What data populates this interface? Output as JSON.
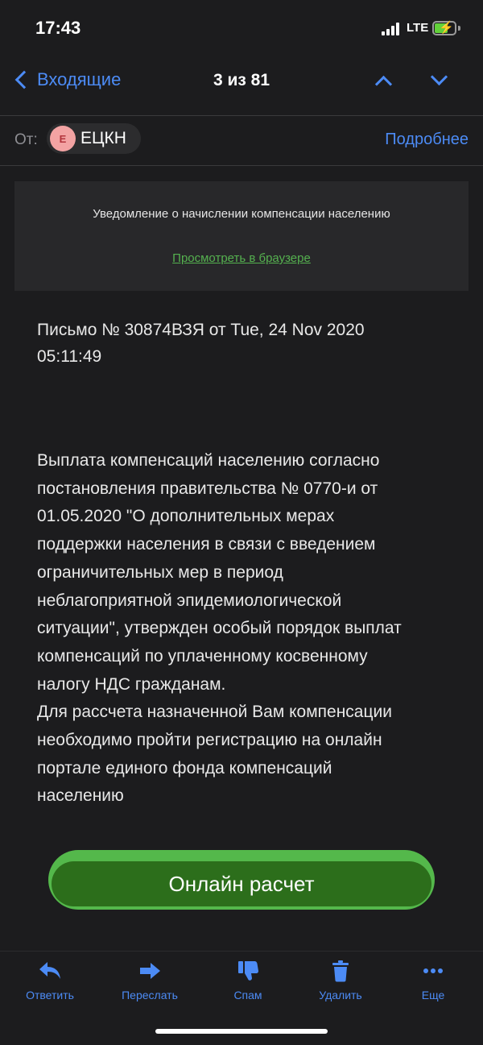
{
  "status": {
    "time": "17:43",
    "network": "LTE"
  },
  "nav": {
    "back_label": "Входящие",
    "position": "3 из 81"
  },
  "header": {
    "from_label": "От:",
    "sender_initial": "Е",
    "sender_name": "ЕЦКН",
    "details_label": "Подробнее"
  },
  "banner": {
    "text": "Уведомление о начислении компенсации населению",
    "link": "Просмотреть в браузере"
  },
  "letter": {
    "meta": [
      "Письмо № 30874ВЗЯ от Tue, 24 Nov 2020",
      "05:11:49"
    ],
    "body": [
      "Выплата компенсаций населению согласно",
      "постановления правительства № 0770-и от",
      "01.05.2020 \"О дополнительных мерах",
      "поддержки населения в связи с введением",
      "ограничительных мер в период",
      "неблагоприятной эпидемиологической",
      "ситуации\", утвержден особый порядок выплат",
      "компенсаций по уплаченному косвенному",
      "налогу НДС гражданам.",
      "Для рассчета назначенной Вам компенсации",
      "необходимо пройти регистрацию на онлайн",
      "портале единого фонда компенсаций",
      "населению"
    ],
    "cta_label": "Онлайн расчет"
  },
  "toolbar": {
    "reply": "Ответить",
    "forward": "Переслать",
    "spam": "Спам",
    "delete": "Удалить",
    "more": "Еще"
  },
  "colors": {
    "accent": "#4c8bf5",
    "link_green": "#55b14f",
    "cta_outer": "#54b84b",
    "cta_inner": "#2c6e1b",
    "background": "#1c1c1e"
  }
}
